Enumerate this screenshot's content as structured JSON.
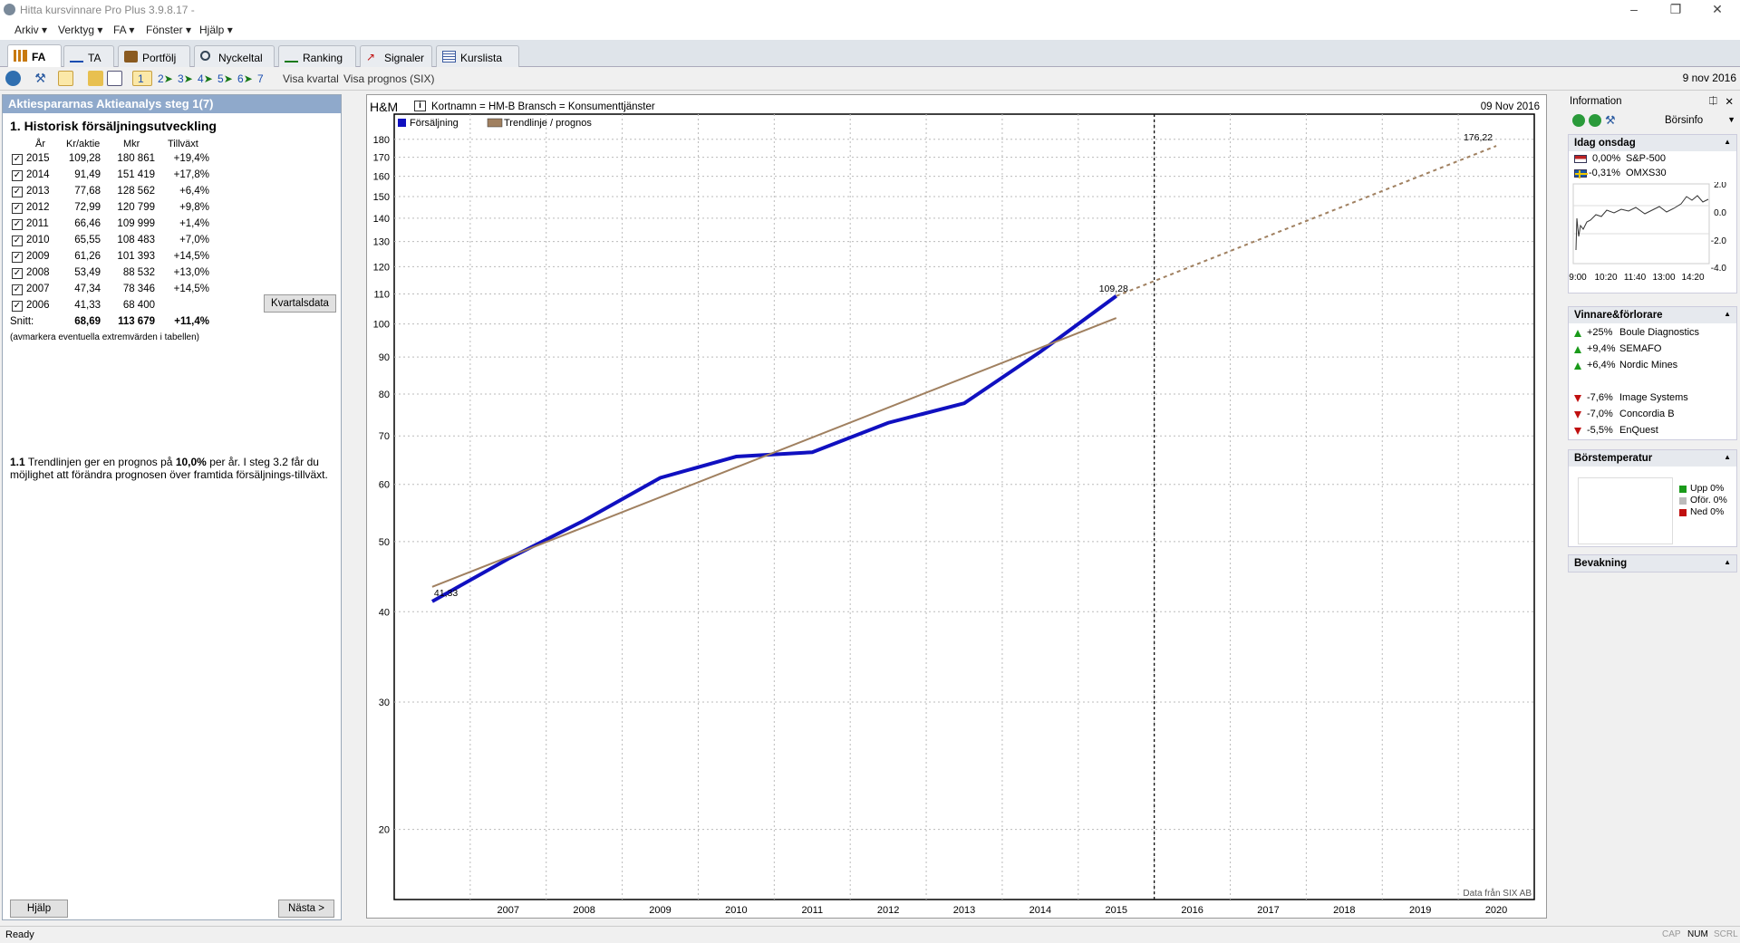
{
  "app": {
    "title": "Hitta kursvinnare Pro Plus 3.9.8.17 -"
  },
  "menu": [
    "Arkiv",
    "Verktyg",
    "FA",
    "Fönster",
    "Hjälp"
  ],
  "tabs": [
    "FA",
    "TA",
    "Portfölj",
    "Nyckeltal",
    "Ranking",
    "Signaler",
    "Kurslista"
  ],
  "toolbar": {
    "steps": [
      "1",
      "2",
      "3",
      "4",
      "5",
      "6",
      "7"
    ],
    "visa_kvartal": "Visa kvartal",
    "visa_prognos": "Visa prognos (SIX)",
    "date": "9 nov 2016"
  },
  "left": {
    "header": "Aktiespararnas Aktieanalys steg 1(7)",
    "section_title": "1. Historisk försäljningsutveckling",
    "columns": [
      "År",
      "Kr/aktie",
      "Mkr",
      "Tillväxt"
    ],
    "rows": [
      {
        "year": "2015",
        "kr": "109,28",
        "mkr": "180 861",
        "growth": "+19,4%"
      },
      {
        "year": "2014",
        "kr": "91,49",
        "mkr": "151 419",
        "growth": "+17,8%"
      },
      {
        "year": "2013",
        "kr": "77,68",
        "mkr": "128 562",
        "growth": "+6,4%"
      },
      {
        "year": "2012",
        "kr": "72,99",
        "mkr": "120 799",
        "growth": "+9,8%"
      },
      {
        "year": "2011",
        "kr": "66,46",
        "mkr": "109 999",
        "growth": "+1,4%"
      },
      {
        "year": "2010",
        "kr": "65,55",
        "mkr": "108 483",
        "growth": "+7,0%"
      },
      {
        "year": "2009",
        "kr": "61,26",
        "mkr": "101 393",
        "growth": "+14,5%"
      },
      {
        "year": "2008",
        "kr": "53,49",
        "mkr": "88 532",
        "growth": "+13,0%"
      },
      {
        "year": "2007",
        "kr": "47,34",
        "mkr": "78 346",
        "growth": "+14,5%"
      },
      {
        "year": "2006",
        "kr": "41,33",
        "mkr": "68 400",
        "growth": ""
      }
    ],
    "avg_label": "Snitt:",
    "avg_kr": "68,69",
    "avg_mkr": "113 679",
    "avg_growth": "+11,4%",
    "hint": "(avmarkera eventuella extremvärden i tabellen)",
    "kvartalsdata_button": "Kvartalsdata",
    "note_num": "1.1",
    "note_a": "Trendlinjen ger en prognos på",
    "note_pct": "10,0%",
    "note_b": "per år.  I steg 3.2 får du möjlighet att förändra prognosen över framtida försäljnings-tillväxt.",
    "help_button": "Hjälp",
    "next_button": "Nästa >"
  },
  "chart_header": {
    "company": "H&M",
    "info": "Kortnamn = HM-B   Bransch = Konsumenttjänster",
    "date": "09 Nov 2016",
    "source": "Data från SIX AB"
  },
  "chart_data": {
    "type": "line",
    "yscale": "log",
    "x_ticks": [
      "2007",
      "2008",
      "2009",
      "2010",
      "2011",
      "2012",
      "2013",
      "2014",
      "2015",
      "2016",
      "2017",
      "2018",
      "2019",
      "2020"
    ],
    "y_ticks": [
      20,
      30,
      40,
      50,
      60,
      70,
      80,
      90,
      100,
      110,
      120,
      130,
      140,
      150,
      160,
      170,
      180
    ],
    "ylim": [
      16,
      195
    ],
    "legend": [
      "Försäljning",
      "Trendlinje / prognos"
    ],
    "series": [
      {
        "name": "Försäljning",
        "color": "#1010c0",
        "x": [
          2006,
          2007,
          2008,
          2009,
          2010,
          2011,
          2012,
          2013,
          2014,
          2015
        ],
        "values": [
          41.33,
          47.34,
          53.49,
          61.26,
          65.55,
          66.46,
          72.99,
          77.68,
          91.49,
          109.28
        ]
      },
      {
        "name": "Trendlinje / prognos",
        "color": "#a08060",
        "x": [
          2006,
          2015
        ],
        "values": [
          43.3,
          101.9
        ]
      },
      {
        "name": "Trendlinje / prognos",
        "color": "#a08060",
        "dashed": true,
        "x": [
          2015,
          2020
        ],
        "values": [
          109.28,
          176.22
        ]
      }
    ],
    "annotations": [
      "41,33",
      "109,28",
      "176,22"
    ]
  },
  "right": {
    "header": "Information",
    "borsinfo": "Börsinfo",
    "idag": "Idag onsdag",
    "indices": [
      {
        "chg": "0,00%",
        "name": "S&P-500"
      },
      {
        "chg": "-0,31%",
        "name": "OMXS30"
      }
    ],
    "spark_y": [
      "2.0",
      "0.0",
      "-2.0",
      "-4.0"
    ],
    "spark_x": [
      "9:00",
      "10:20",
      "11:40",
      "13:00",
      "14:20"
    ],
    "winners_header": "Vinnare&förlorare",
    "winners": [
      {
        "chg": "+25%",
        "name": "Boule Diagnostics"
      },
      {
        "chg": "+9,4%",
        "name": "SEMAFO"
      },
      {
        "chg": "+6,4%",
        "name": "Nordic Mines"
      }
    ],
    "losers": [
      {
        "chg": "-7,6%",
        "name": "Image Systems"
      },
      {
        "chg": "-7,0%",
        "name": "Concordia B"
      },
      {
        "chg": "-5,5%",
        "name": "EnQuest"
      }
    ],
    "temp_header": "Börstemperatur",
    "temp_legend": [
      "Upp 0%",
      "Oför. 0%",
      "Ned 0%"
    ],
    "bevakning": "Bevakning"
  },
  "status": {
    "text": "Ready",
    "cap": "CAP",
    "num": "NUM",
    "scrl": "SCRL"
  }
}
